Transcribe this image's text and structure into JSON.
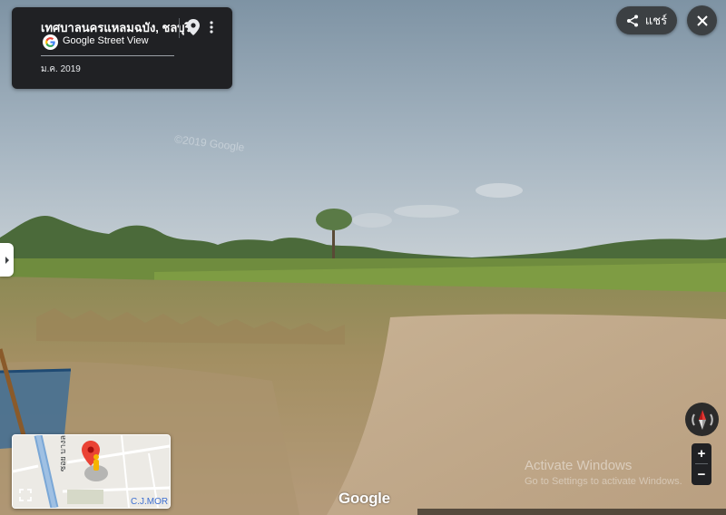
{
  "info_card": {
    "place_name": "เทศบาลนครแหลมฉบัง, ชลบุรี",
    "source_label": "Google Street View",
    "capture_date": "ม.ค. 2019"
  },
  "toolbar": {
    "share_label": "แชร์"
  },
  "zoom": {
    "in_label": "+",
    "out_label": "−"
  },
  "minimap": {
    "road_label": "ซอย บางละ",
    "corner_label": "C.J.MOR"
  },
  "branding": {
    "google_logo": "Google",
    "copyright_watermark": "©2019 Google"
  },
  "os_watermark": {
    "title": "Activate Windows",
    "subtitle": "Go to Settings to activate Windows."
  },
  "colors": {
    "panel_bg": "#202124",
    "button_bg": "#3c4043",
    "map_pin_red": "#ea4335",
    "pegman_yellow": "#f5b400"
  },
  "icons": [
    "map-pin-icon",
    "more-vert-icon",
    "street-view-logo-icon",
    "share-icon",
    "close-icon",
    "chevron-right-icon",
    "compass-icon",
    "fullscreen-icon"
  ]
}
